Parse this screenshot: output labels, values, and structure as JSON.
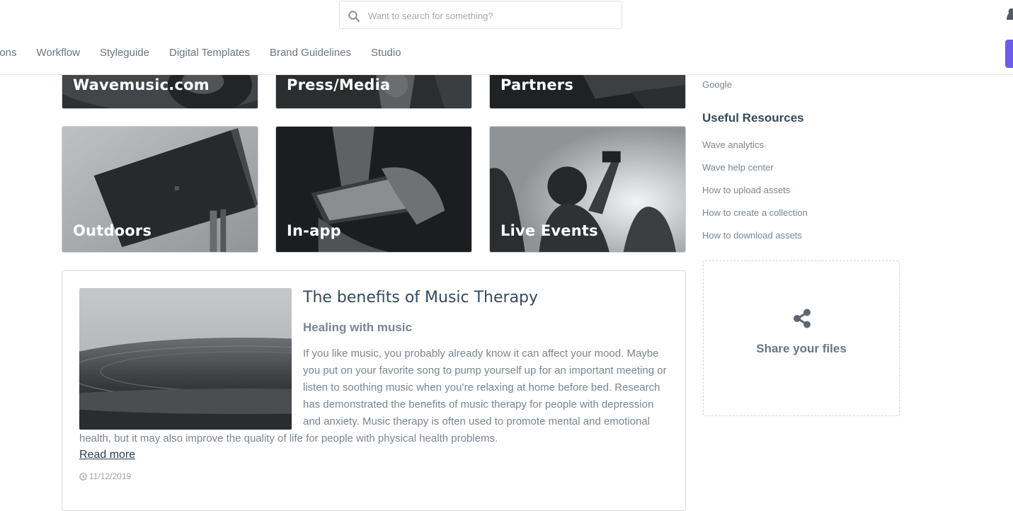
{
  "search": {
    "placeholder": "Want to search for something?"
  },
  "nav": {
    "items": [
      {
        "label": "ections"
      },
      {
        "label": "Workflow"
      },
      {
        "label": "Styleguide"
      },
      {
        "label": "Digital Templates"
      },
      {
        "label": "Brand Guidelines"
      },
      {
        "label": "Studio"
      }
    ]
  },
  "tiles": {
    "top": [
      {
        "label": "Wavemusic.com"
      },
      {
        "label": "Press/Media"
      },
      {
        "label": "Partners"
      }
    ],
    "bottom": [
      {
        "label": "Outdoors"
      },
      {
        "label": "In-app"
      },
      {
        "label": "Live Events"
      }
    ]
  },
  "article": {
    "title": "The benefits of Music Therapy",
    "subtitle": "Healing with music",
    "body": "If you like music, you probably already know it can affect your mood. Maybe you put on your favorite song to pump yourself up for an important meeting or listen to soothing music when you’re relaxing at home before bed. Research has demonstrated the benefits of music therapy for people with depression and anxiety. Music therapy is often used to promote mental and emotional health, but it may also improve the quality of life for people with physical health problems.",
    "read_more": "Read more",
    "date": "11/12/2019"
  },
  "sidebar": {
    "top_link": "Google",
    "resources_heading": "Useful Resources",
    "resources": [
      {
        "label": "Wave analytics"
      },
      {
        "label": "Wave help center"
      },
      {
        "label": "How to upload assets"
      },
      {
        "label": "How to create a collection"
      },
      {
        "label": "How to download assets"
      }
    ],
    "share_label": "Share your files"
  },
  "icons": {
    "search": "search-icon",
    "clock": "clock-icon",
    "share": "share-icon",
    "user": "user-icon"
  },
  "colors": {
    "accent": "#6c5ce7",
    "text_dark": "#34495e",
    "text_muted": "#7a8591"
  }
}
